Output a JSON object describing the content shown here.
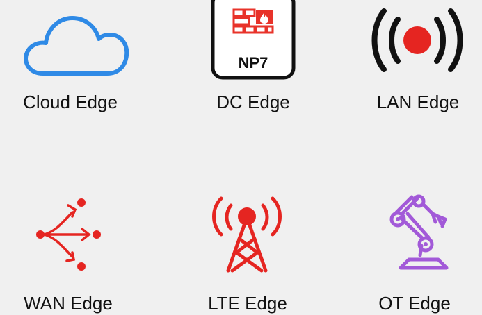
{
  "tiles": [
    {
      "label": "Cloud Edge",
      "icon": "cloud-icon",
      "color": "#2f8ae6"
    },
    {
      "label": "DC Edge",
      "icon": "np7-firewall-icon",
      "color": "#e8332a",
      "chip_text": "NP7"
    },
    {
      "label": "LAN Edge",
      "icon": "broadcast-icon",
      "color": "#e52521"
    },
    {
      "label": "WAN Edge",
      "icon": "wan-split-icon",
      "color": "#e52521"
    },
    {
      "label": "LTE Edge",
      "icon": "cell-tower-icon",
      "color": "#e52521"
    },
    {
      "label": "OT Edge",
      "icon": "robotic-arm-icon",
      "color": "#a259d8"
    }
  ]
}
